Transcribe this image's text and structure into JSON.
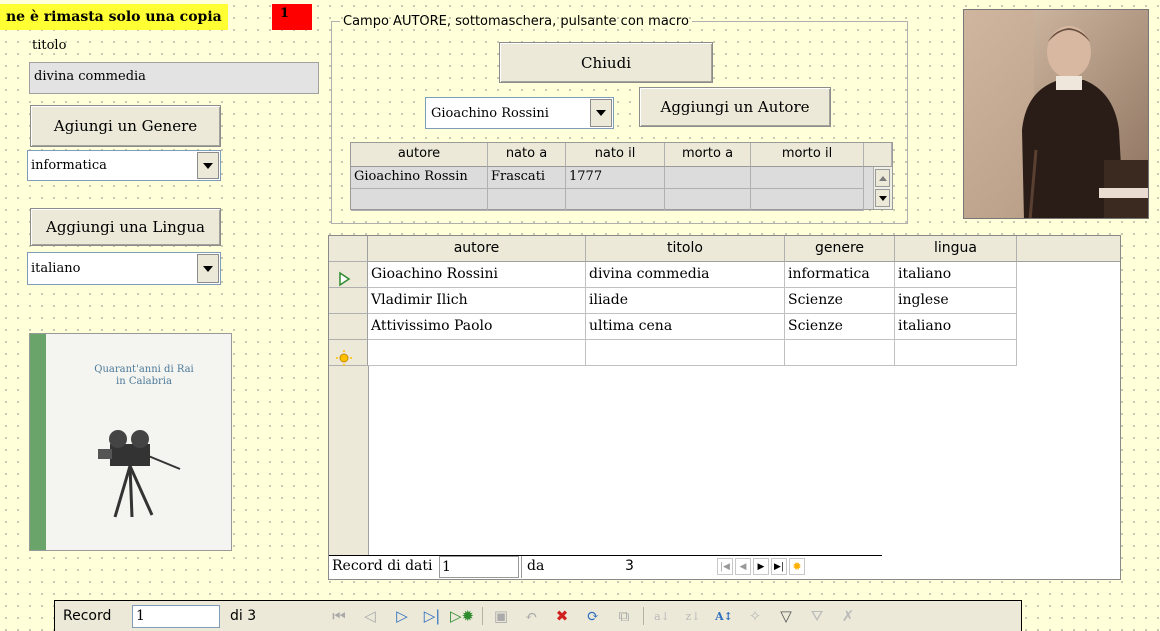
{
  "banner": {
    "text": "ne è rimasta solo una copia",
    "count": "1"
  },
  "titolo": {
    "label": "titolo",
    "value": "divina commedia"
  },
  "genere": {
    "button": "Agiungi un Genere",
    "value": "informatica"
  },
  "lingua": {
    "button": "Aggiungi una Lingua",
    "value": "italiano"
  },
  "autore_group": {
    "legend": "Campo AUTORE, sottomaschera, pulsante con macro",
    "close_button": "Chiudi",
    "author_select": "Gioachino Rossini",
    "add_author_button": "Aggiungi un Autore",
    "subform": {
      "columns": [
        "autore",
        "nato a",
        "nato il",
        "morto a",
        "morto il"
      ],
      "rows": [
        [
          "Gioachino Rossin",
          "Frascati",
          "1777",
          "",
          ""
        ]
      ]
    }
  },
  "book_cover": {
    "title_line1": "Quarant'anni di Rai",
    "title_line2": "in Calabria"
  },
  "main_grid": {
    "columns": [
      "autore",
      "titolo",
      "genere",
      "lingua"
    ],
    "rows": [
      [
        "Gioachino Rossini",
        "divina commedia",
        "informatica",
        "italiano"
      ],
      [
        "Vladimir Ilich",
        "iliade",
        "Scienze",
        "inglese"
      ],
      [
        "Attivissimo Paolo",
        "ultima cena",
        "Scienze",
        "italiano"
      ]
    ],
    "nav": {
      "label": "Record di dati",
      "current": "1",
      "of_label": "da",
      "total": "3"
    }
  },
  "form_nav": {
    "label": "Record",
    "current": "1",
    "of_label": "di 3"
  },
  "colors": {
    "background": "#ffffd9",
    "banner": "#ffff33",
    "badge": "#ff0000",
    "nav_active": "#2e8b2e"
  }
}
